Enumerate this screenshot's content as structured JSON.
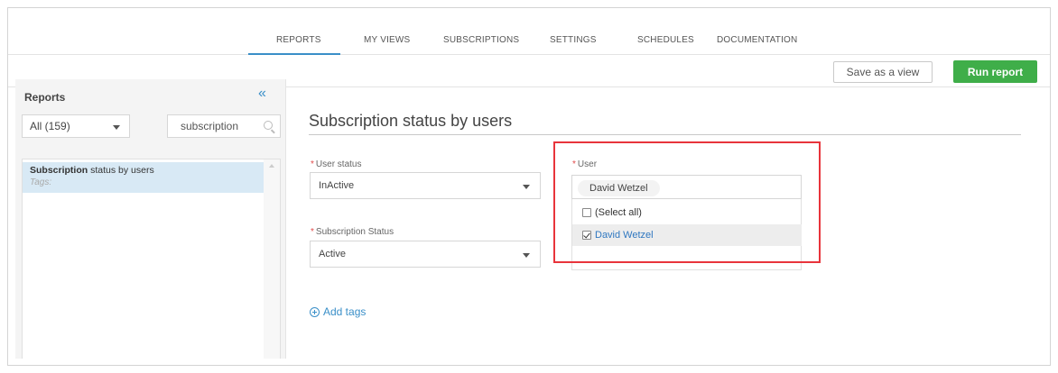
{
  "nav": {
    "tabs": [
      {
        "label": "REPORTS",
        "active": true
      },
      {
        "label": "MY VIEWS"
      },
      {
        "label": "SUBSCRIPTIONS"
      },
      {
        "label": "SETTINGS"
      },
      {
        "label": "SCHEDULES"
      },
      {
        "label": "DOCUMENTATION"
      }
    ]
  },
  "toolbar": {
    "save_view_label": "Save as a view",
    "run_report_label": "Run report"
  },
  "sidebar": {
    "title": "Reports",
    "collapse_glyph": "«",
    "filter_value": "All (159)",
    "search_value": "subscription",
    "items": [
      {
        "name_bold": "Subscription",
        "name_rest": " status by users",
        "tags": "Tags:",
        "selected": true
      }
    ]
  },
  "main": {
    "title": "Subscription status by users",
    "user_status": {
      "label": "User status",
      "value": "InActive"
    },
    "subscription_status": {
      "label": "Subscription Status",
      "value": "Active"
    },
    "user": {
      "label": "User",
      "selected_chip": "David Wetzel",
      "options": [
        {
          "label": "(Select all)",
          "checked": false
        },
        {
          "label": "David Wetzel",
          "checked": true
        }
      ]
    },
    "required_marker": "*",
    "add_tags_label": "Add tags"
  },
  "colors": {
    "accent": "#3a8fc8",
    "run_button": "#3fae49",
    "highlight_box": "#e8343b"
  }
}
